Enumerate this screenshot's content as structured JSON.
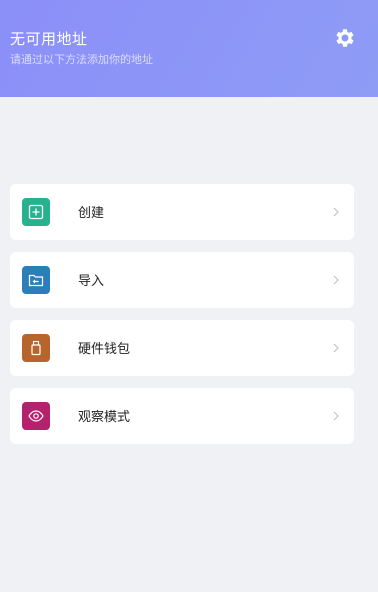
{
  "header": {
    "title": "无可用地址",
    "subtitle": "请通过以下方法添加你的地址",
    "settings_icon": "gear-icon"
  },
  "items": [
    {
      "label": "创建",
      "icon": "plus-square-icon",
      "color": "#26b28c"
    },
    {
      "label": "导入",
      "icon": "folder-import-icon",
      "color": "#2b7fb8"
    },
    {
      "label": "硬件钱包",
      "icon": "usb-stick-icon",
      "color": "#b8652d"
    },
    {
      "label": "观察模式",
      "icon": "eye-icon",
      "color": "#b4226e"
    }
  ],
  "colors": {
    "header_gradient_start": "#8b8ff8",
    "header_gradient_end": "#8e9cf6",
    "background": "#f0f1f5"
  }
}
